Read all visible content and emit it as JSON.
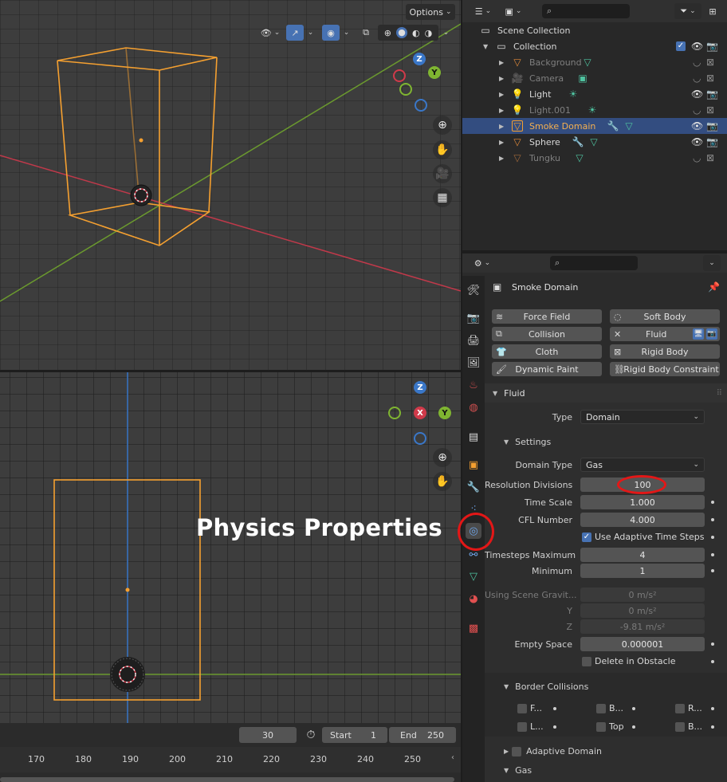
{
  "viewport_top": {
    "options_label": "Options"
  },
  "timeline": {
    "current_frame": "30",
    "start_label": "Start",
    "start_value": "1",
    "end_label": "End",
    "end_value": "250",
    "ruler_numbers": [
      "170",
      "180",
      "190",
      "200",
      "210",
      "220",
      "230",
      "240",
      "250"
    ]
  },
  "gizmo": {
    "x": "X",
    "y": "Y",
    "z": "Z"
  },
  "outliner": {
    "search_placeholder": "",
    "scene_collection": "Scene Collection",
    "collection": "Collection",
    "items": [
      {
        "name": "Background",
        "dim": true
      },
      {
        "name": "Camera",
        "dim": true
      },
      {
        "name": "Light",
        "dim": false
      },
      {
        "name": "Light.001",
        "dim": true
      },
      {
        "name": "Smoke Domain",
        "dim": false,
        "selected": true
      },
      {
        "name": "Sphere",
        "dim": false
      },
      {
        "name": "Tungku",
        "dim": true
      }
    ]
  },
  "properties": {
    "object_name": "Smoke Domain",
    "physics_buttons": {
      "force_field": "Force Field",
      "soft_body": "Soft Body",
      "collision": "Collision",
      "fluid": "Fluid",
      "cloth": "Cloth",
      "rigid_body": "Rigid Body",
      "dynamic_paint": "Dynamic Paint",
      "rigid_body_constraint": "Rigid Body Constraint"
    },
    "fluid_panel": "Fluid",
    "type_label": "Type",
    "type_value": "Domain",
    "settings_label": "Settings",
    "domain_type_label": "Domain Type",
    "domain_type_value": "Gas",
    "resolution_label": "Resolution Divisions",
    "resolution_value": "100",
    "time_scale_label": "Time Scale",
    "time_scale_value": "1.000",
    "cfl_label": "CFL Number",
    "cfl_value": "4.000",
    "adaptive_label": "Use Adaptive Time Steps",
    "timesteps_max_label": "Timesteps Maximum",
    "timesteps_max_value": "4",
    "minimum_label": "Minimum",
    "minimum_value": "1",
    "gravity_label": "Using Scene Gravit...",
    "gravity_x": "0 m/s²",
    "gravity_y_label": "Y",
    "gravity_y": "0 m/s²",
    "gravity_z_label": "Z",
    "gravity_z": "-9.81 m/s²",
    "empty_space_label": "Empty Space",
    "empty_space_value": "0.000001",
    "delete_obstacle_label": "Delete in Obstacle",
    "border_collisions_label": "Border Collisions",
    "border": [
      "F...",
      "B...",
      "R...",
      "L...",
      "Top",
      "B..."
    ],
    "adaptive_domain_label": "Adaptive Domain",
    "gas_label": "Gas"
  },
  "annotation": {
    "text": "Physics Properties",
    "ring_color": "#e31717"
  },
  "colors": {
    "selection": "#334d80",
    "accent_blue": "#4772b3",
    "object_orange": "#f5a030",
    "axis_red": "#d03a4a",
    "axis_green": "#6b9a2e",
    "axis_blue": "#3a77c8"
  }
}
